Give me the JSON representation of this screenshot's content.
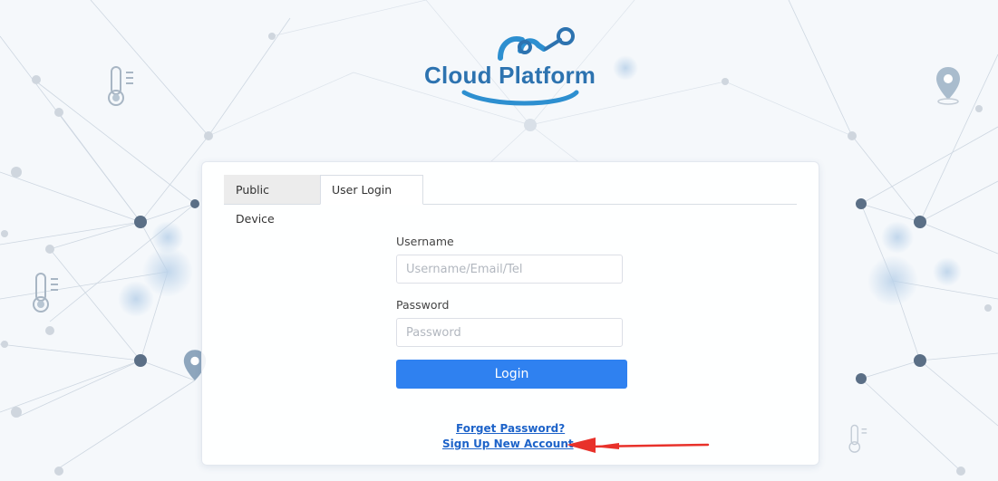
{
  "brand": {
    "logo_text": "Cloud Platform",
    "logo_color": "#2d73b0"
  },
  "tabs": [
    {
      "label": "Public Device",
      "active": false
    },
    {
      "label": "User Login",
      "active": true
    }
  ],
  "form": {
    "username": {
      "label": "Username",
      "placeholder": "Username/Email/Tel",
      "value": ""
    },
    "password": {
      "label": "Password",
      "placeholder": "Password",
      "value": ""
    },
    "login_label": "Login"
  },
  "links": {
    "forget_password": "Forget Password?",
    "sign_up": "Sign Up New Account"
  },
  "colors": {
    "primary": "#2f81f0",
    "link": "#1d63c9",
    "annotation_arrow": "#e8312a"
  },
  "icons": [
    "thermometer-icon",
    "location-pin-icon"
  ]
}
